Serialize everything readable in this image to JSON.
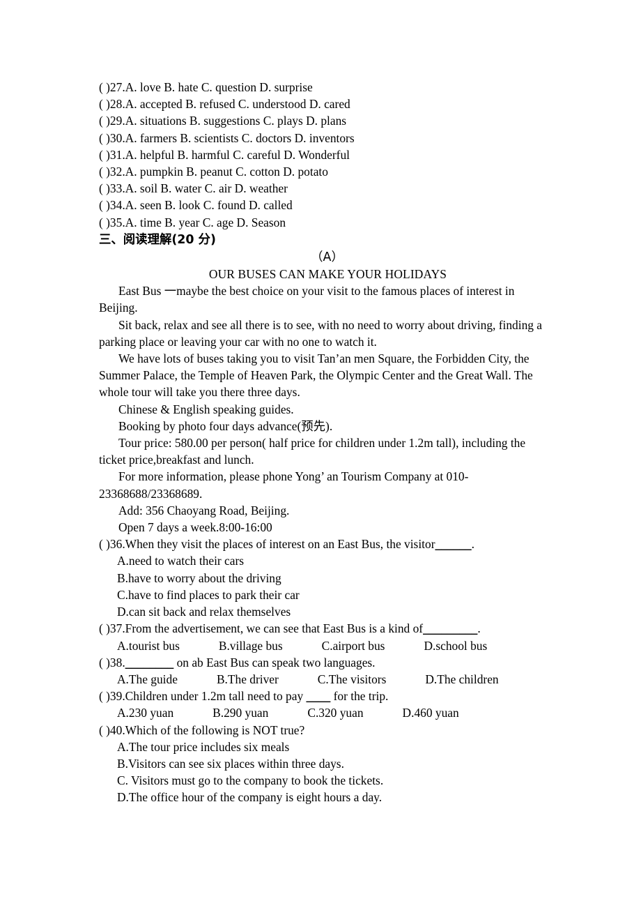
{
  "document": {
    "type": "exam-paper",
    "language": "en-zh",
    "page_background": "#ffffff",
    "text_color": "#000000"
  },
  "cloze_options": [
    "( )27.A. love B. hate C. question D. surprise",
    "( )28.A. accepted B. refused C. understood D. cared",
    "( )29.A. situations B. suggestions C. plays D. plans",
    "( )30.A. farmers B. scientists C. doctors D. inventors",
    "( )31.A. helpful B. harmful C. careful D. Wonderful",
    "( )32.A. pumpkin B. peanut C. cotton D. potato",
    "( )33.A. soil B. water C. air D. weather",
    "( )34.A. seen B. look C. found D. called",
    "( )35.A. time B. year C. age D. Season"
  ],
  "section": {
    "heading": "三、阅读理解(20 分)",
    "passage_label": "（A）",
    "passage_title": "OUR BUSES CAN MAKE YOUR HOLIDAYS"
  },
  "passage": {
    "paragraphs": [
      "East Bus 一maybe the best choice on your visit to the famous places of interest in Beijing.",
      "Sit back, relax and see all there is to see, with no need to worry about driving, finding a parking place or leaving your car with no one to watch it.",
      "We have lots of buses taking you to visit Tan’an men Square, the Forbidden City, the Summer Palace, the Temple of Heaven Park, the Olympic Center and the Great Wall. The whole tour will take you there three days.",
      "Chinese & English speaking guides.",
      "Booking by photo four days advance(预先).",
      "Tour price:     580.00 per person( half price for children under 1.2m tall), including the ticket price,breakfast and lunch.",
      "For more information, please phone Yong’ an Tourism Company at 010-23368688/23368689.",
      "Add: 356 Chaoyang Road, Beijing.",
      "Open 7 days a week.8:00-16:00"
    ]
  },
  "questions": [
    {
      "stem_prefix": "( )36.When they visit the places of interest on an East Bus, the visitor",
      "blank": "______",
      "stem_suffix": ".",
      "layout": "stacked",
      "options": [
        "A.need to watch their cars",
        "B.have to worry about the driving",
        "C.have to find places to park their car",
        "D.can sit back and relax themselves"
      ]
    },
    {
      "stem_prefix": "( )37.From the advertisement, we can see that East Bus is a kind of",
      "blank": "_________",
      "stem_suffix": ".",
      "layout": "inline",
      "options": [
        "A.tourist bus",
        "B.village bus",
        "C.airport bus",
        "D.school bus"
      ]
    },
    {
      "stem_prefix": "( )38.",
      "blank": "________",
      "stem_suffix": " on ab East Bus can speak two languages.",
      "layout": "inline",
      "options": [
        "A.The guide",
        "B.The driver",
        "C.The visitors",
        "D.The children"
      ]
    },
    {
      "stem_prefix": "( )39.Children under 1.2m tall need to pay ",
      "blank": "____",
      "stem_suffix": " for the trip.",
      "layout": "inline",
      "options": [
        "A.230 yuan",
        "B.290 yuan",
        "C.320 yuan",
        "D.460 yuan"
      ]
    },
    {
      "stem_prefix": "( )40.Which of the following is NOT true?",
      "blank": "",
      "stem_suffix": "",
      "layout": "stacked",
      "options": [
        "A.The tour price includes six meals",
        "B.Visitors can see six places within three days.",
        "C. Visitors must go to the company to book the tickets.",
        "D.The office hour of the company is eight hours a day."
      ]
    }
  ]
}
